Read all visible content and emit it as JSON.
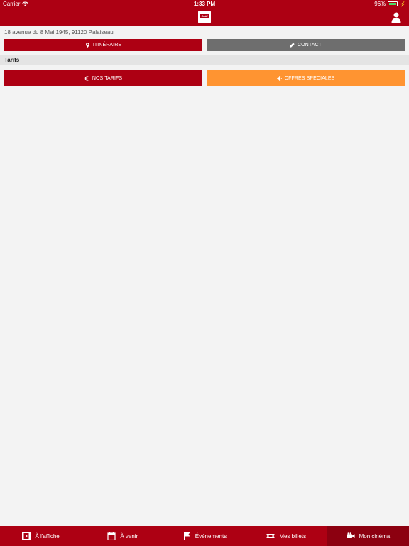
{
  "status_bar": {
    "carrier": "Carrier",
    "time": "1:33 PM",
    "battery": "96%",
    "battery_level": 0.96
  },
  "header": {
    "logo_text": "Gaûf",
    "logo_icon": "cinema-logo",
    "user_icon": "user-icon"
  },
  "cinema": {
    "address": "18 avenue du 8 Mai 1945, 91120 Palaiseau"
  },
  "actions": {
    "itinerary_label": "ITINÉRAIRE",
    "contact_label": "CONTACT"
  },
  "tarifs": {
    "section_title": "Tarifs",
    "our_prices_label": "NOS TARIFS",
    "special_offers_label": "OFFRES SPÉCIALES"
  },
  "colors": {
    "brand": "#ad0013",
    "secondary": "#6e6e6e",
    "offers": "#ff9431",
    "background": "#f3f3f3"
  },
  "tabs": [
    {
      "label": "À l'affiche",
      "icon": "film-icon"
    },
    {
      "label": "À venir",
      "icon": "calendar-icon"
    },
    {
      "label": "Événements",
      "icon": "flag-icon"
    },
    {
      "label": "Mes billets",
      "icon": "ticket-icon"
    },
    {
      "label": "Mon cinéma",
      "icon": "video-camera-icon",
      "active": true
    }
  ]
}
